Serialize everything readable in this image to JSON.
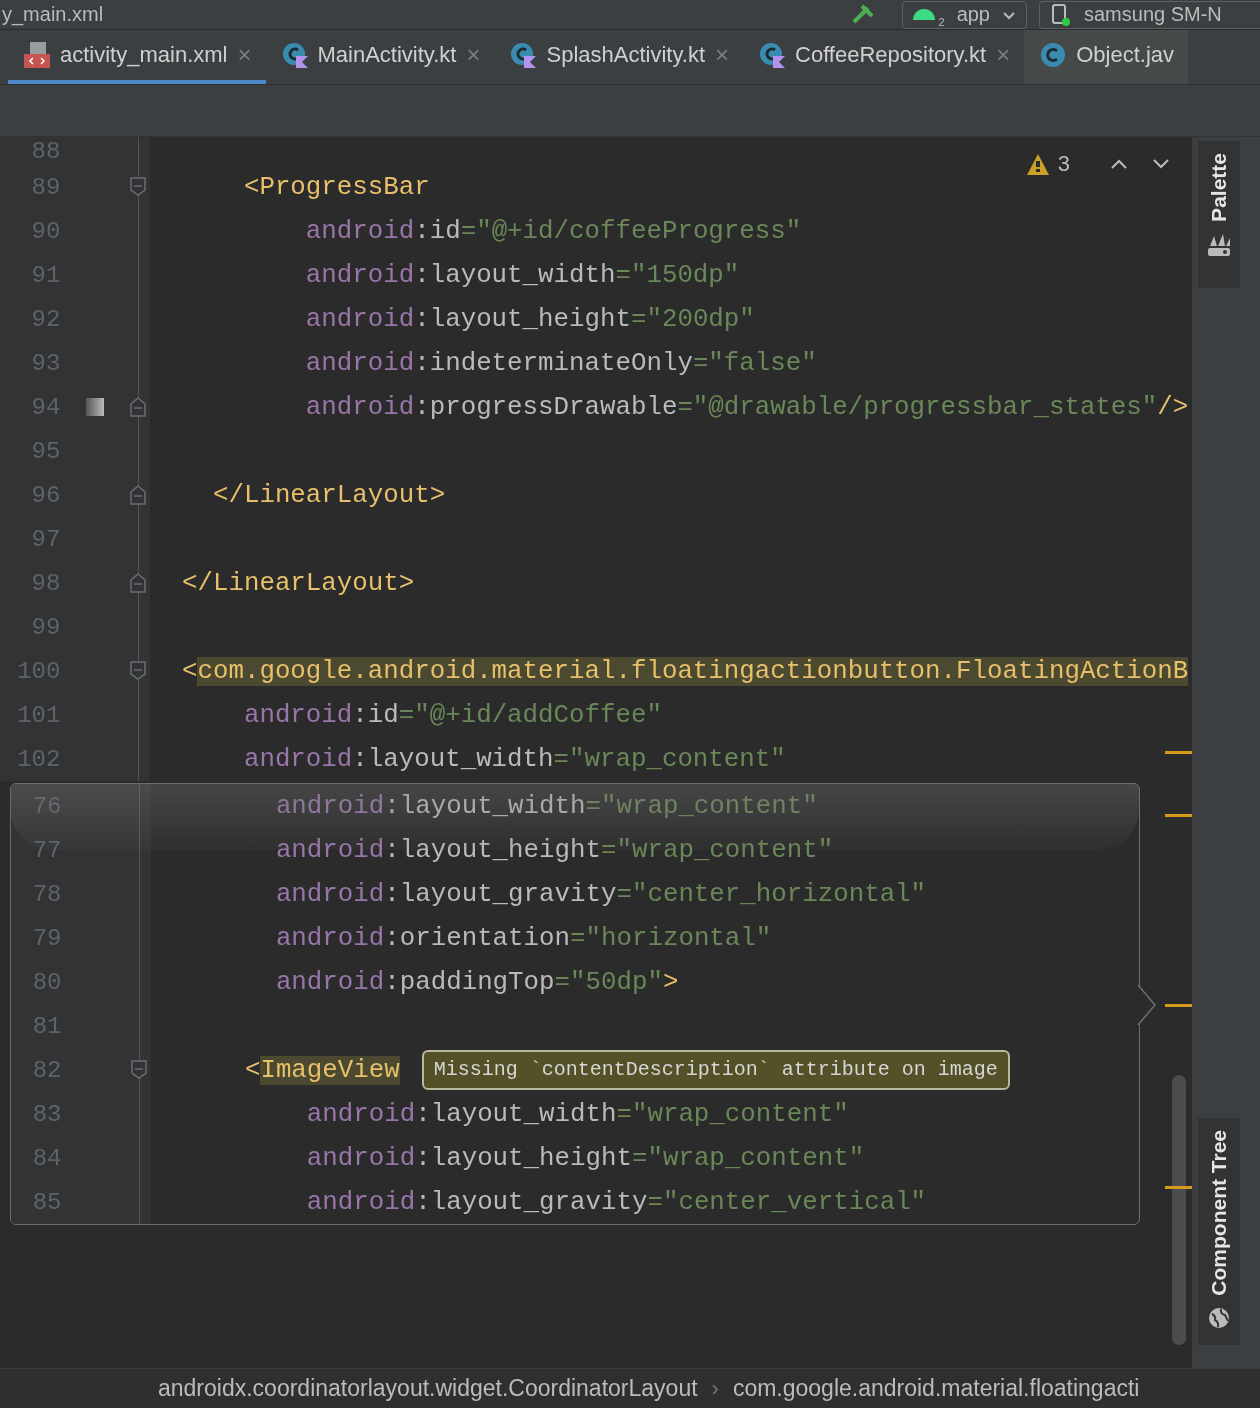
{
  "title_bar": {
    "file_title": "y_main.xml",
    "run_config": {
      "label": "app",
      "badge": "2"
    },
    "device": {
      "label": "samsung SM-N"
    }
  },
  "tabs": [
    {
      "label": "activity_main.xml",
      "kind": "xml",
      "selected": true,
      "close": "×"
    },
    {
      "label": "MainActivity.kt",
      "kind": "kotlin",
      "selected": false,
      "close": "×"
    },
    {
      "label": "SplashActivity.kt",
      "kind": "kotlin",
      "selected": false,
      "close": "×"
    },
    {
      "label": "CoffeeRepository.kt",
      "kind": "kotlin",
      "selected": false,
      "close": "×"
    },
    {
      "label": "Object.jav",
      "kind": "java",
      "selected": false
    }
  ],
  "inspections": {
    "count": "3"
  },
  "lines": [
    {
      "number": "88",
      "kind": "partial"
    },
    {
      "number": "89",
      "fold_start": true,
      "tokens": [
        {
          "kind": "tag",
          "text": "    <ProgressBar"
        }
      ]
    },
    {
      "number": "90",
      "tokens": [
        {
          "kind": "ns",
          "text": "        android"
        },
        {
          "kind": "attr",
          "text": ":id"
        },
        {
          "kind": "value",
          "text": "=\"@+id/coffeeProgress\""
        }
      ]
    },
    {
      "number": "91",
      "tokens": [
        {
          "kind": "ns",
          "text": "        android"
        },
        {
          "kind": "attr",
          "text": ":layout_width"
        },
        {
          "kind": "value",
          "text": "=\"150dp\""
        }
      ]
    },
    {
      "number": "92",
      "tokens": [
        {
          "kind": "ns",
          "text": "        android"
        },
        {
          "kind": "attr",
          "text": ":layout_height"
        },
        {
          "kind": "value",
          "text": "=\"200dp\""
        }
      ]
    },
    {
      "number": "93",
      "tokens": [
        {
          "kind": "ns",
          "text": "        android"
        },
        {
          "kind": "attr",
          "text": ":indeterminateOnly"
        },
        {
          "kind": "value",
          "text": "=\"false\""
        }
      ]
    },
    {
      "number": "94",
      "fold_end": true,
      "drawable_preview": true,
      "tokens": [
        {
          "kind": "ns",
          "text": "        android"
        },
        {
          "kind": "attr",
          "text": ":progressDrawable"
        },
        {
          "kind": "value",
          "text": "=\"@drawable/progressbar_states\""
        },
        {
          "kind": "tag",
          "text": "/>"
        }
      ]
    },
    {
      "number": "95"
    },
    {
      "number": "96",
      "fold_end": true,
      "tokens": [
        {
          "kind": "tag",
          "text": "  </LinearLayout>"
        }
      ]
    },
    {
      "number": "97"
    },
    {
      "number": "98",
      "fold_end": true,
      "tokens": [
        {
          "kind": "tag",
          "text": "</LinearLayout>"
        }
      ]
    },
    {
      "number": "99"
    },
    {
      "number": "100",
      "fold_start": true,
      "tokens": [
        {
          "kind": "tag",
          "text": "<"
        },
        {
          "kind": "tag-highlight",
          "text": "com.google.android.material.floatingactionbutton.FloatingActionB"
        }
      ]
    },
    {
      "number": "101",
      "tokens": [
        {
          "kind": "ns",
          "text": "    android"
        },
        {
          "kind": "attr",
          "text": ":id"
        },
        {
          "kind": "value",
          "text": "=\"@+id/addCoffee\""
        }
      ]
    },
    {
      "number": "102",
      "tokens": [
        {
          "kind": "ns",
          "text": "    android"
        },
        {
          "kind": "attr",
          "text": ":layout_width"
        },
        {
          "kind": "value",
          "text": "=\"wrap_content\""
        }
      ]
    }
  ],
  "sticky_popup": {
    "lines": [
      {
        "number": "76",
        "tokens": [
          {
            "kind": "ns",
            "text": "      android"
          },
          {
            "kind": "attr",
            "text": ":layout_width"
          },
          {
            "kind": "value",
            "text": "=\"wrap_content\""
          }
        ]
      },
      {
        "number": "77",
        "tokens": [
          {
            "kind": "ns",
            "text": "      android"
          },
          {
            "kind": "attr",
            "text": ":layout_height"
          },
          {
            "kind": "value",
            "text": "=\"wrap_content\""
          }
        ]
      },
      {
        "number": "78",
        "tokens": [
          {
            "kind": "ns",
            "text": "      android"
          },
          {
            "kind": "attr",
            "text": ":layout_gravity"
          },
          {
            "kind": "value",
            "text": "=\"center_horizontal\""
          }
        ]
      },
      {
        "number": "79",
        "tokens": [
          {
            "kind": "ns",
            "text": "      android"
          },
          {
            "kind": "attr",
            "text": ":orientation"
          },
          {
            "kind": "value",
            "text": "=\"horizontal\""
          }
        ]
      },
      {
        "number": "80",
        "tokens": [
          {
            "kind": "ns",
            "text": "      android"
          },
          {
            "kind": "attr",
            "text": ":paddingTop"
          },
          {
            "kind": "value",
            "text": "=\"50dp\""
          },
          {
            "kind": "tag",
            "text": ">"
          }
        ]
      },
      {
        "number": "81"
      },
      {
        "number": "82",
        "fold_start": true,
        "tooltip": "Missing `contentDescription` attribute on image",
        "tokens": [
          {
            "kind": "tag",
            "text": "    <"
          },
          {
            "kind": "tag-highlight",
            "text": "ImageView"
          }
        ]
      },
      {
        "number": "83",
        "tokens": [
          {
            "kind": "ns",
            "text": "        android"
          },
          {
            "kind": "attr",
            "text": ":layout_width"
          },
          {
            "kind": "value",
            "text": "=\"wrap_content\""
          }
        ]
      },
      {
        "number": "84",
        "tokens": [
          {
            "kind": "ns",
            "text": "        android"
          },
          {
            "kind": "attr",
            "text": ":layout_height"
          },
          {
            "kind": "value",
            "text": "=\"wrap_content\""
          }
        ]
      },
      {
        "number": "85",
        "tokens": [
          {
            "kind": "ns",
            "text": "        android"
          },
          {
            "kind": "attr",
            "text": ":layout_gravity"
          },
          {
            "kind": "value",
            "text": "=\"center_vertical\""
          }
        ]
      }
    ]
  },
  "side_tabs": [
    {
      "label": "Palette",
      "kind": "palette"
    },
    {
      "label": "Component Tree",
      "kind": "tree"
    }
  ],
  "breadcrumbs": {
    "items": [
      "androidx.coordinatorlayout.widget.CoordinatorLayout",
      "com.google.android.material.floatingacti"
    ],
    "separator": "›"
  }
}
